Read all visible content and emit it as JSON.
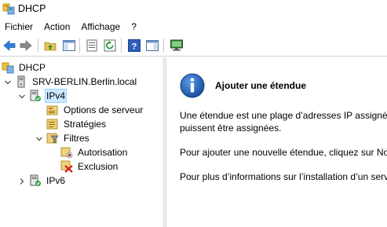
{
  "window": {
    "title": "DHCP"
  },
  "menu": [
    "Fichier",
    "Action",
    "Affichage",
    "?"
  ],
  "toolbar": {
    "buttons": [
      "back-icon",
      "forward-icon",
      "up-folder-icon",
      "show-hide-tree-icon",
      "export-list-icon",
      "refresh-icon",
      "help-icon",
      "action-pane-icon",
      "monitor-icon"
    ]
  },
  "tree": {
    "root": "DHCP",
    "server": "SRV-BERLIN.Berlin.local",
    "ipv4": "IPv4",
    "server_options": "Options de serveur",
    "policies": "Stratégies",
    "filters": "Filtres",
    "allow": "Autorisation",
    "deny": "Exclusion",
    "ipv6": "IPv6"
  },
  "content": {
    "heading": "Ajouter une étendue",
    "para1_line1": "Une étendue est une plage d’adresses IP assignées",
    "para1_line2": "puissent être assignées.",
    "para2": "Pour ajouter une nouvelle étendue, cliquez sur Nou",
    "para3": "Pour plus d’informations sur l’installation d’un serv"
  },
  "colors": {
    "selection": "#cce8ff",
    "selection_border": "#99d1ff",
    "info_blue": "#1a5fb4"
  }
}
